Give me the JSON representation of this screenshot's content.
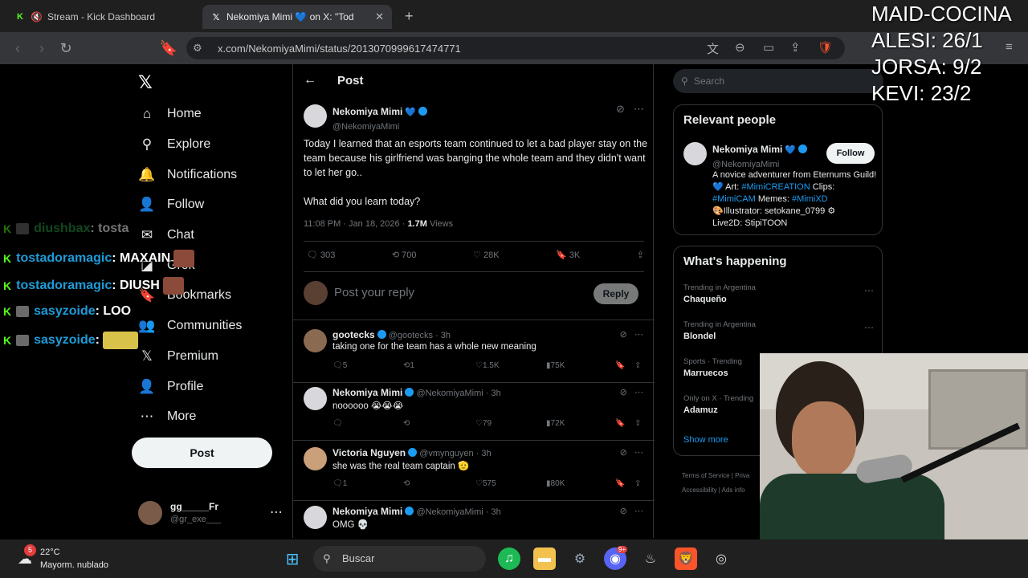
{
  "browser": {
    "tabs": [
      {
        "title": "Stream - Kick Dashboard",
        "active": false
      },
      {
        "title": "Nekomiya Mimi 💙 on X: \"Tod",
        "active": true
      }
    ],
    "url": "x.com/NekomiyaMimi/status/2013070999617474771"
  },
  "x": {
    "nav": [
      {
        "label": "Home",
        "icon": "home-icon",
        "glyph": "⌂"
      },
      {
        "label": "Explore",
        "icon": "search-icon",
        "glyph": "⚲"
      },
      {
        "label": "Notifications",
        "icon": "bell-icon",
        "glyph": "🔔"
      },
      {
        "label": "Follow",
        "icon": "add-person-icon",
        "glyph": "👤"
      },
      {
        "label": "Chat",
        "icon": "mail-icon",
        "glyph": "✉"
      },
      {
        "label": "Grok",
        "icon": "grok-icon",
        "glyph": "◪"
      },
      {
        "label": "Bookmarks",
        "icon": "bookmark-icon",
        "glyph": "🔖"
      },
      {
        "label": "Communities",
        "icon": "communities-icon",
        "glyph": "👥"
      },
      {
        "label": "Premium",
        "icon": "x-logo-icon",
        "glyph": "𝕏"
      },
      {
        "label": "Profile",
        "icon": "profile-icon",
        "glyph": "👤"
      },
      {
        "label": "More",
        "icon": "more-circle-icon",
        "glyph": "⋯"
      }
    ],
    "post_button": "Post",
    "account": {
      "name": "gg_____Fr",
      "handle": "@gr_exe___"
    },
    "header_title": "Post",
    "post": {
      "author": "Nekomiya Mimi",
      "handle": "@NekomiyaMimi",
      "text_1": "Today I learned that an esports team continued to let a bad player stay on the team because his girlfriend was banging the whole team and they didn't want to let her go..",
      "text_2": "What did you learn today?",
      "timestamp": "11:08 PM · Jan 18, 2026 · ",
      "views_num": "1.7M",
      "views_label": " Views",
      "replies": "303",
      "reposts": "700",
      "likes": "28K",
      "bookmarks": "3K"
    },
    "reply_placeholder": "Post your reply",
    "reply_button": "Reply",
    "replies": [
      {
        "name": "gootecks",
        "handle": "@gootecks · 3h",
        "text": "taking one for the team has a whole new meaning",
        "replies": "5",
        "reposts": "1",
        "likes": "1.5K",
        "views": "75K"
      },
      {
        "name": "Nekomiya Mimi",
        "handle": "@NekomiyaMimi · 3h",
        "text": "noooooo 😭😭😭",
        "replies": "",
        "reposts": "",
        "likes": "79",
        "views": "72K"
      },
      {
        "name": "Victoria Nguyen",
        "handle": "@vmynguyen · 3h",
        "text": "she was the real team captain 🫡",
        "replies": "1",
        "reposts": "",
        "likes": "575",
        "views": "80K"
      },
      {
        "name": "Nekomiya Mimi",
        "handle": "@NekomiyaMimi · 3h",
        "text": "OMG 💀",
        "replies": "",
        "reposts": "",
        "likes": "",
        "views": ""
      }
    ],
    "search_placeholder": "Search",
    "relevant": {
      "title": "Relevant people",
      "name": "Nekomiya Mimi",
      "handle": "@NekomiyaMimi",
      "follow": "Follow",
      "bio_1": "A novice adventurer from Eternums Guild! ",
      "bio_art": "Art: ",
      "bio_art_link": "#MimiCREATION",
      "bio_clips": "Clips: ",
      "bio_clips_link": "#MimiCAM",
      "bio_memes": " Memes: ",
      "bio_memes_link": "#MimiXD",
      "bio_illus": "🎨Illustrator: setokane_0799 ⚙",
      "bio_live2d": "Live2D: StipiTOON"
    },
    "happening": {
      "title": "What's happening",
      "trends": [
        {
          "context": "Trending in Argentina",
          "topic": "Chaqueño"
        },
        {
          "context": "Trending in Argentina",
          "topic": "Blondel"
        },
        {
          "context": "Sports · Trending",
          "topic": "Marruecos"
        },
        {
          "context": "Only on X · Trending",
          "topic": "Adamuz"
        }
      ],
      "show_more": "Show more"
    },
    "footer": {
      "line1": "Terms of Service  |  Priva",
      "line2": "Accessibility  |  Ads info"
    }
  },
  "overlay": {
    "scores": [
      "MAID-COCINA",
      "ALESI: 26/1",
      "JORSA: 9/2",
      "KEVI: 23/2"
    ],
    "chat": [
      {
        "user": "diushbax",
        "msg": " : tosta",
        "dim": true
      },
      {
        "user": "tostadoramagic",
        "msg": " : MAXAIN"
      },
      {
        "user": "tostadoramagic",
        "msg": " : DIUSH"
      },
      {
        "user": "sasyzoide",
        "msg": " : LOO"
      },
      {
        "user": "sasyzoide",
        "msg": " : "
      }
    ]
  },
  "taskbar": {
    "weather_temp": "22°C",
    "weather_desc": "Mayorm. nublado",
    "notif_count": "5",
    "search": "Buscar",
    "discord_badge": "9+"
  },
  "colors": {
    "accent": "#1d9bf0",
    "kick": "#53fc18",
    "bg": "#000000"
  }
}
